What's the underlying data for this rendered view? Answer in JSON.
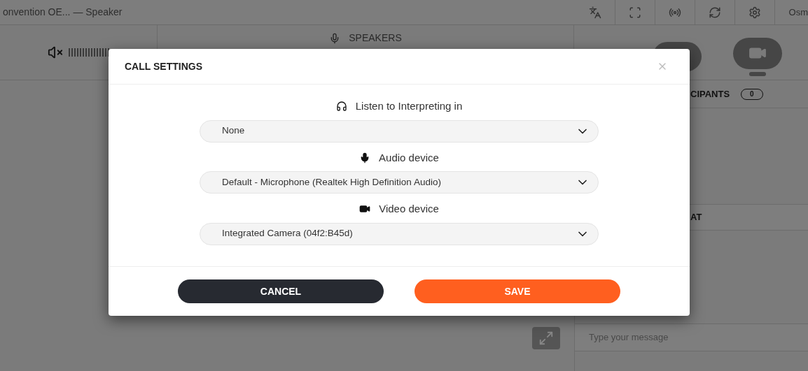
{
  "window": {
    "title": "onvention OE... — Speaker",
    "user": "Osm"
  },
  "speakers_panel": {
    "title": "SPEAKERS"
  },
  "participants": {
    "title": "CIPANTS",
    "count": "0"
  },
  "chat": {
    "title": "AT",
    "placeholder": "Type your message"
  },
  "dialog": {
    "title": "CALL SETTINGS",
    "fields": [
      {
        "kind": "interpreting",
        "label": "Listen to Interpreting in",
        "value": "None"
      },
      {
        "kind": "audio",
        "label": "Audio device",
        "value": "Default - Microphone (Realtek High Definition Audio)"
      },
      {
        "kind": "video",
        "label": "Video device",
        "value": "Integrated Camera (04f2:B45d)"
      }
    ],
    "buttons": [
      {
        "kind": "cancel",
        "label": "CANCEL"
      },
      {
        "kind": "save",
        "label": "SAVE"
      }
    ]
  }
}
